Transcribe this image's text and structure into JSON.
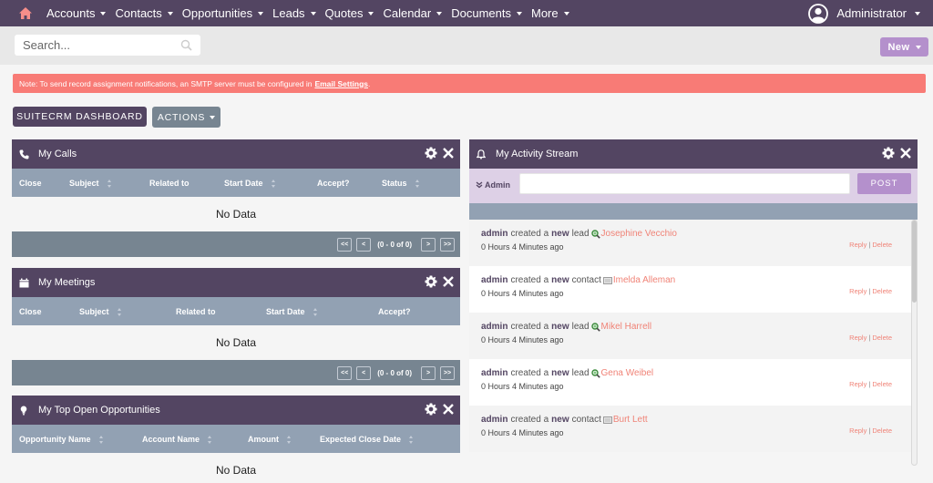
{
  "nav": {
    "items": [
      {
        "label": "Accounts"
      },
      {
        "label": "Contacts"
      },
      {
        "label": "Opportunities"
      },
      {
        "label": "Leads"
      },
      {
        "label": "Quotes"
      },
      {
        "label": "Calendar"
      },
      {
        "label": "Documents"
      },
      {
        "label": "More"
      }
    ],
    "user": "Administrator",
    "home_icon": "home-icon",
    "home_color": "#f78e8a"
  },
  "search": {
    "placeholder": "Search...",
    "value": ""
  },
  "new_button": "New",
  "alert": {
    "text": "Note: To send record assignment notifications, an SMTP server must be configured in",
    "link": "Email Settings",
    "suffix": "."
  },
  "toolbar": {
    "dashboard_label": "SUITECRM DASHBOARD",
    "actions_label": "ACTIONS"
  },
  "dashlets": {
    "calls": {
      "title": "My Calls",
      "icon": "phone-icon",
      "columns": [
        "Close",
        "Subject",
        "Related to",
        "Start Date",
        "Accept?",
        "Status"
      ],
      "empty": "No Data",
      "pager": {
        "first": "<<",
        "prev": "<",
        "info": "(0 - 0 of 0)",
        "next": ">",
        "last": ">>"
      }
    },
    "meetings": {
      "title": "My Meetings",
      "icon": "calendar-icon",
      "columns": [
        "Close",
        "Subject",
        "Related to",
        "Start Date",
        "Accept?"
      ],
      "empty": "No Data",
      "pager": {
        "first": "<<",
        "prev": "<",
        "info": "(0 - 0 of 0)",
        "next": ">",
        "last": ">>"
      }
    },
    "opportunities": {
      "title": "My Top Open Opportunities",
      "icon": "lightbulb-icon",
      "columns": [
        "Opportunity Name",
        "Account Name",
        "Amount",
        "Expected Close Date"
      ],
      "empty": "No Data"
    },
    "activity": {
      "title": "My Activity Stream",
      "icon": "bell-icon",
      "user_label": "Admin",
      "post_label": "POST",
      "post_value": "",
      "reply_label": "Reply",
      "delete_label": "Delete",
      "items": [
        {
          "user": "admin",
          "verb": "created a",
          "adj": "new",
          "type": "lead",
          "name": "Josephine Vecchio",
          "time": "0 Hours 4 Minutes ago"
        },
        {
          "user": "admin",
          "verb": "created a",
          "adj": "new",
          "type": "contact",
          "name": "Imelda Alleman",
          "time": "0 Hours 4 Minutes ago"
        },
        {
          "user": "admin",
          "verb": "created a",
          "adj": "new",
          "type": "lead",
          "name": "Mikel Harrell",
          "time": "0 Hours 4 Minutes ago"
        },
        {
          "user": "admin",
          "verb": "created a",
          "adj": "new",
          "type": "lead",
          "name": "Gena Weibel",
          "time": "0 Hours 4 Minutes ago"
        },
        {
          "user": "admin",
          "verb": "created a",
          "adj": "new",
          "type": "contact",
          "name": "Burt Lett",
          "time": "0 Hours 4 Minutes ago"
        }
      ]
    }
  },
  "colors": {
    "brand": "#534562",
    "column_header": "#92a1b3",
    "pager": "#778591",
    "accent": "#b490cc",
    "alert": "#f87b76",
    "link": "#f08377"
  }
}
